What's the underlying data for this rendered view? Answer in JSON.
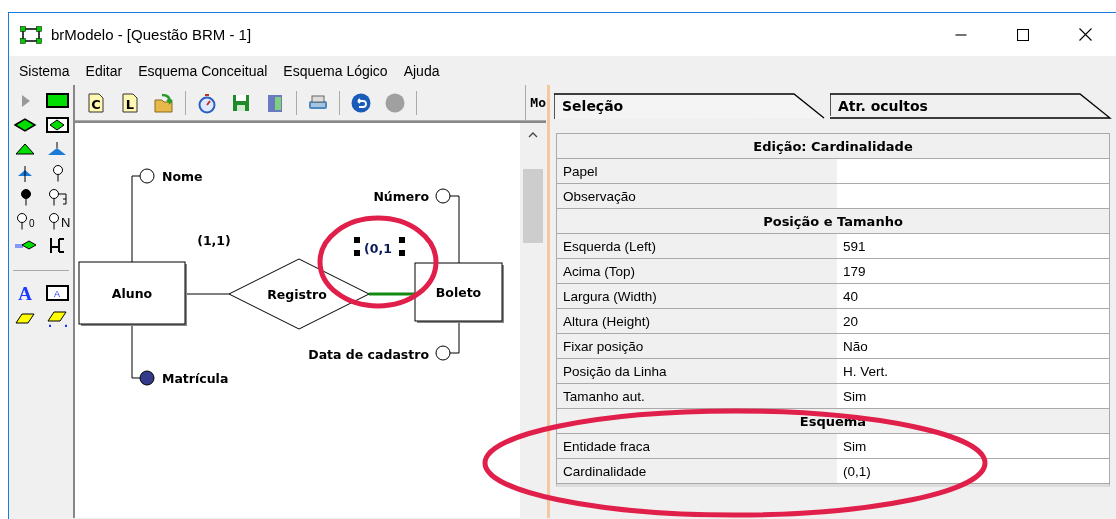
{
  "window": {
    "title": "brModelo - [Questão BRM - 1]"
  },
  "menu": [
    "Sistema",
    "Editar",
    "Esquema Conceitual",
    "Esquema Lógico",
    "Ajuda"
  ],
  "toolbar": [
    {
      "kind": "doc",
      "label": "C"
    },
    {
      "kind": "doc",
      "label": "L"
    },
    {
      "kind": "open"
    },
    {
      "kind": "separator"
    },
    {
      "kind": "timer"
    },
    {
      "kind": "save"
    },
    {
      "kind": "exit"
    },
    {
      "kind": "separator"
    },
    {
      "kind": "print"
    },
    {
      "kind": "separator"
    },
    {
      "kind": "undo"
    },
    {
      "kind": "record",
      "disabled": true
    },
    {
      "kind": "separator"
    }
  ],
  "toolbar_label": "Mo",
  "palette": [
    {
      "kind": "pointer"
    },
    {
      "kind": "entity"
    },
    {
      "kind": "relationship"
    },
    {
      "kind": "assoc"
    },
    {
      "kind": "spec"
    },
    {
      "kind": "spec2"
    },
    {
      "kind": "spec1"
    },
    {
      "kind": "attr"
    },
    {
      "kind": "ident"
    },
    {
      "kind": "composite"
    },
    {
      "kind": "attr",
      "glyph": "0"
    },
    {
      "kind": "attr",
      "glyph": "N"
    },
    {
      "kind": "selfrel"
    },
    {
      "kind": "link"
    },
    {
      "kind": "separator"
    },
    {
      "kind": "text",
      "glyph": "A"
    },
    {
      "kind": "note",
      "glyph": "A"
    },
    {
      "kind": "eraser"
    },
    {
      "kind": "eraser-sel"
    }
  ],
  "diagram": {
    "entities": [
      {
        "name": "Aluno"
      },
      {
        "name": "Boleto"
      }
    ],
    "relationships": [
      {
        "name": "Registro"
      }
    ],
    "attributes": [
      {
        "name": "Nome",
        "identifier": false
      },
      {
        "name": "Matrícula",
        "identifier": true
      },
      {
        "name": "Número",
        "identifier": false
      },
      {
        "name": "Data de cadastro",
        "identifier": false
      }
    ],
    "cardinalities": [
      {
        "text": "(1,1)",
        "selected": false
      },
      {
        "text": "(0,1",
        "selected": true
      }
    ]
  },
  "tabs": [
    {
      "label": "Seleção",
      "selected": true
    },
    {
      "label": "Atr. ocultos",
      "selected": false
    }
  ],
  "properties": [
    {
      "kind": "section",
      "label": "Edição: Cardinalidade"
    },
    {
      "kind": "property",
      "label": "Papel"
    },
    {
      "kind": "property",
      "label": "Observação"
    },
    {
      "kind": "section",
      "label": "Posição e Tamanho"
    },
    {
      "kind": "property",
      "label": "Esquerda (Left)",
      "value": "591"
    },
    {
      "kind": "property",
      "label": "Acima (Top)",
      "value": "179"
    },
    {
      "kind": "property",
      "label": "Largura (Width)",
      "value": "40"
    },
    {
      "kind": "property",
      "label": "Altura (Height)",
      "value": "20"
    },
    {
      "kind": "property",
      "label": "Fixar posição",
      "value": "Não"
    },
    {
      "kind": "property",
      "label": "Posição da Linha",
      "value": "H. Vert."
    },
    {
      "kind": "property",
      "label": "Tamanho aut.",
      "value": "Sim"
    },
    {
      "kind": "section",
      "label": "Esquema"
    },
    {
      "kind": "property",
      "label": "Entidade fraca",
      "value": "Sim"
    },
    {
      "kind": "property",
      "label": "Cardinalidade",
      "value": "(0,1)"
    }
  ]
}
